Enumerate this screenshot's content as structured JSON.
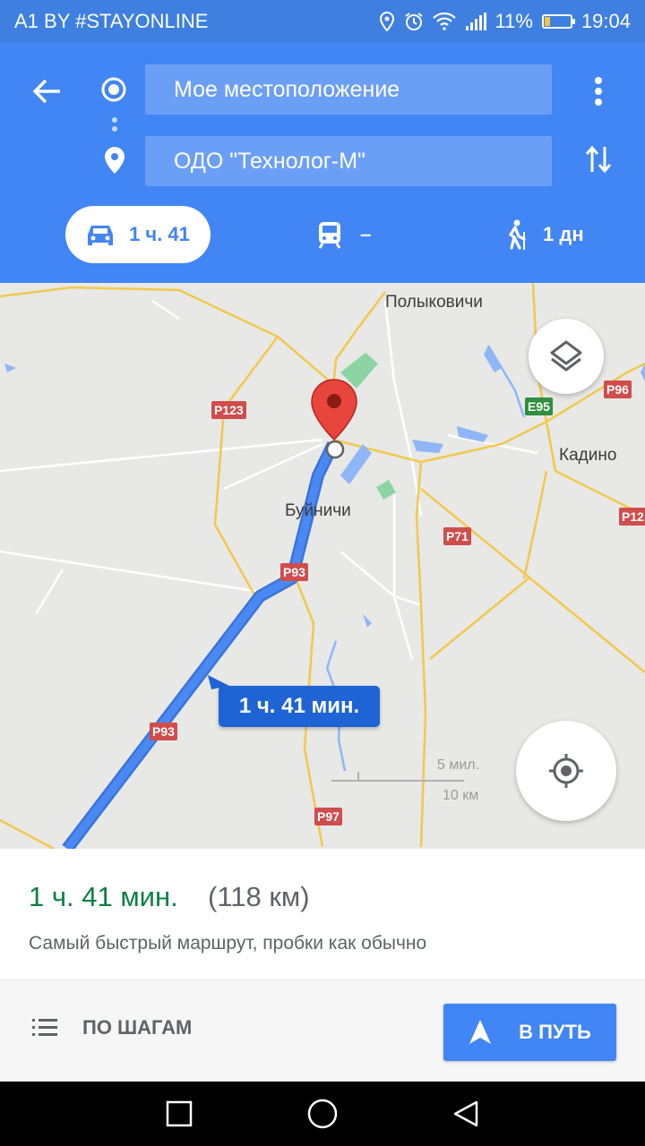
{
  "status_bar": {
    "carrier": "A1 BY #STAYONLINE",
    "battery": "11%",
    "battery_level": 0.11,
    "time": "19:04"
  },
  "header": {
    "origin": "Мое местоположение",
    "destination": "ОДО \"Технолог-М\""
  },
  "modes": {
    "car": "1 ч. 41",
    "transit": "–",
    "walk": "1 дн"
  },
  "map": {
    "places": {
      "polykovichi": "Полыковичи",
      "kadino": "Кадино",
      "buynichi": "Буйничи"
    },
    "shields": {
      "r123": "P123",
      "e95": "E95",
      "r96": "P96",
      "r12": "P12",
      "r71": "P71",
      "r93_upper": "P93",
      "r93_lower": "P93",
      "r97": "P97"
    },
    "route_callout": "1 ч. 41 мин.",
    "scale": {
      "miles": "5 мил.",
      "km": "10 км"
    }
  },
  "summary": {
    "duration": "1 ч. 41 мин.",
    "distance": "(118 км)",
    "description": "Самый быстрый маршрут, пробки как обычно"
  },
  "actions": {
    "steps_label": "ПО ШАГАМ",
    "start_label": "В ПУТЬ"
  },
  "colors": {
    "header": "#4285f4",
    "status_bar": "#3f7fe0",
    "route": "#4a89f3",
    "duration": "#0b8043",
    "callout": "#1e64d4"
  }
}
